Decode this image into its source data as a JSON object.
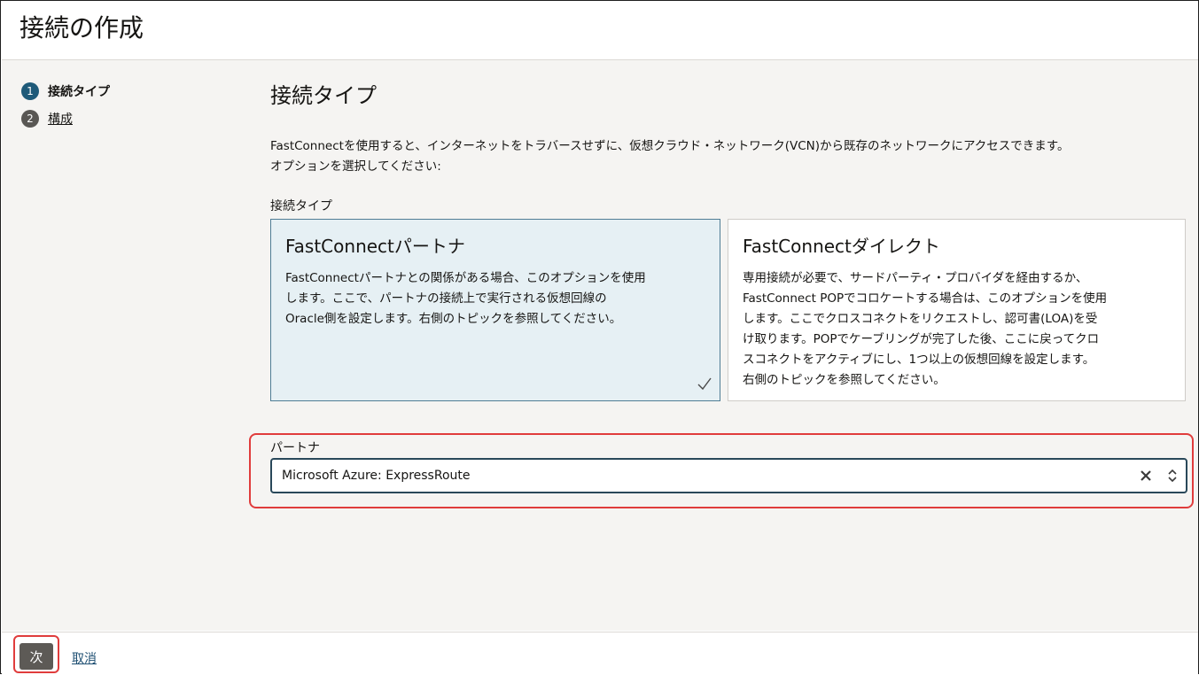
{
  "header": {
    "title": "接続の作成"
  },
  "steps": [
    {
      "number": "1",
      "label": "接続タイプ",
      "state": "current"
    },
    {
      "number": "2",
      "label": "構成",
      "state": "link"
    }
  ],
  "main": {
    "section_title": "接続タイプ",
    "description_lines": [
      "FastConnectを使用すると、インターネットをトラバースせずに、仮想クラウド・ネットワーク(VCN)から既存のネットワークにアクセスできます。",
      "オプションを選択してください:"
    ],
    "connection_type_label": "接続タイプ",
    "cards": [
      {
        "title": "FastConnectパートナ",
        "selected": true,
        "text_lines": [
          "FastConnectパートナとの関係がある場合、このオプションを使用",
          "します。ここで、パートナの接続上で実行される仮想回線の",
          "Oracle側を設定します。右側のトピックを参照してください。"
        ]
      },
      {
        "title": "FastConnectダイレクト",
        "selected": false,
        "text_lines": [
          "専用接続が必要で、サードパーティ・プロバイダを経由するか、",
          "FastConnect POPでコロケートする場合は、このオプションを使用",
          "します。ここでクロスコネクトをリクエストし、認可書(LOA)を受",
          "け取ります。POPでケーブリングが完了した後、ここに戻ってクロ",
          "スコネクトをアクティブにし、1つ以上の仮想回線を設定します。",
          "右側のトピックを参照してください。"
        ]
      }
    ],
    "partner": {
      "label": "パートナ",
      "value": "Microsoft Azure: ExpressRoute"
    }
  },
  "footer": {
    "next_label": "次",
    "cancel_label": "取消"
  },
  "colors": {
    "accent": "#1e5a79",
    "selected_card_bg": "#e6f0f4",
    "highlight_red": "#e03c3c",
    "content_bg": "#f5f4f2",
    "button_bg": "#5d5a56"
  },
  "icons": {
    "check": "check-icon",
    "clear": "clear-icon",
    "select": "chevron-up-down-icon"
  }
}
